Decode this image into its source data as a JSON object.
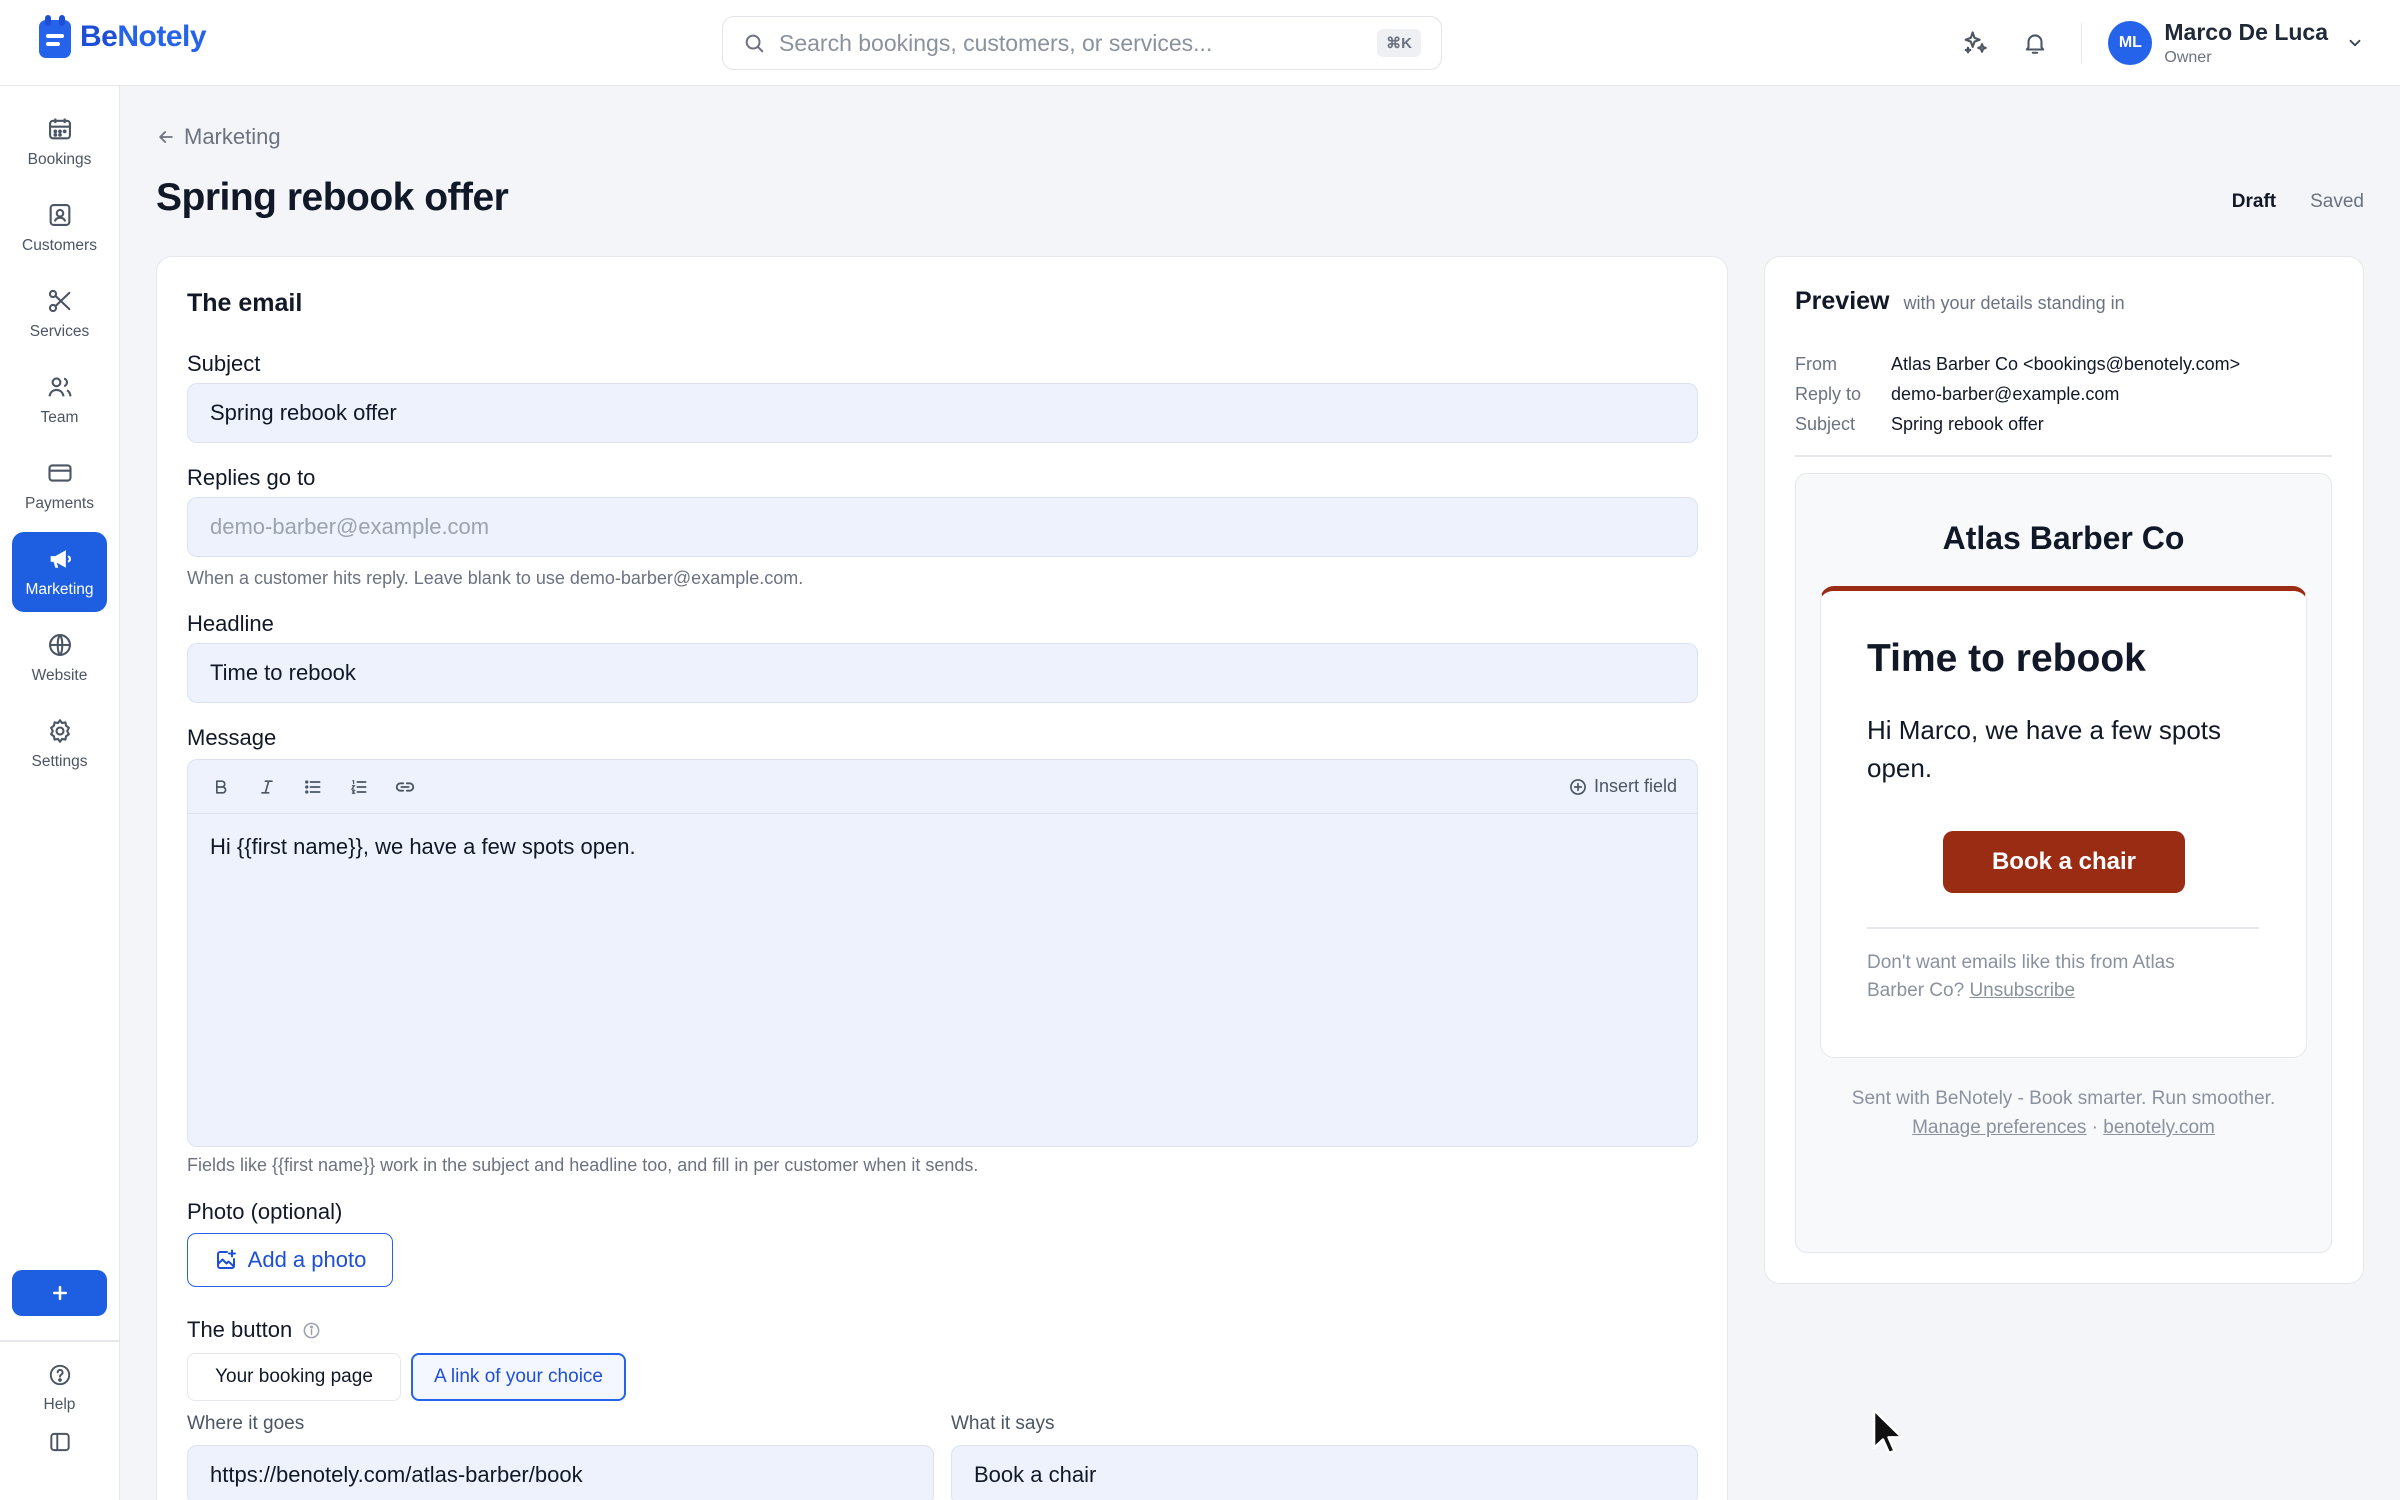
{
  "brand": {
    "name_part1": "Be",
    "name_part2": "Notely",
    "accent": "#2563eb"
  },
  "search": {
    "placeholder": "Search bookings, customers, or services...",
    "shortcut": "⌘K"
  },
  "user": {
    "initials": "ML",
    "name": "Marco De Luca",
    "role": "Owner"
  },
  "sidebar": {
    "items": [
      {
        "label": "Bookings",
        "icon": "calendar-icon",
        "active": false
      },
      {
        "label": "Customers",
        "icon": "contact-icon",
        "active": false
      },
      {
        "label": "Services",
        "icon": "scissors-icon",
        "active": false
      },
      {
        "label": "Team",
        "icon": "users-icon",
        "active": false
      },
      {
        "label": "Payments",
        "icon": "credit-card-icon",
        "active": false
      },
      {
        "label": "Marketing",
        "icon": "megaphone-icon",
        "active": true
      },
      {
        "label": "Website",
        "icon": "globe-icon",
        "active": false
      },
      {
        "label": "Settings",
        "icon": "gear-icon",
        "active": false
      }
    ],
    "help_label": "Help"
  },
  "breadcrumb": {
    "back_label": "Marketing"
  },
  "page": {
    "title": "Spring rebook offer",
    "status_draft": "Draft",
    "status_saved": "Saved"
  },
  "editor": {
    "heading": "The email",
    "subject_label": "Subject",
    "subject_value": "Spring rebook offer",
    "replies_label": "Replies go to",
    "replies_placeholder": "demo-barber@example.com",
    "replies_hint": "When a customer hits reply. Leave blank to use demo-barber@example.com.",
    "headline_label": "Headline",
    "headline_value": "Time to rebook",
    "message_label": "Message",
    "insert_field_label": "Insert field",
    "message_value": "Hi {{first name}}, we have a few spots open.",
    "fields_hint": "Fields like {{first name}} work in the subject and headline too, and fill in per customer when it sends.",
    "photo_label": "Photo (optional)",
    "add_photo_label": "Add a photo",
    "button_heading": "The button",
    "button_options": [
      "Your booking page",
      "A link of your choice"
    ],
    "button_selected": "A link of your choice",
    "where_label": "Where it goes",
    "where_value": "https://benotely.com/atlas-barber/book",
    "what_label": "What it says",
    "what_value": "Book a chair"
  },
  "preview": {
    "title": "Preview",
    "subtitle": "with your details standing in",
    "from_label": "From",
    "from_value": "Atlas Barber Co <bookings@benotely.com>",
    "reply_label": "Reply to",
    "reply_value": "demo-barber@example.com",
    "subject_label": "Subject",
    "subject_value": "Spring rebook offer",
    "email": {
      "brand": "Atlas Barber Co",
      "headline": "Time to rebook",
      "body": "Hi Marco, we have a few spots open.",
      "button": "Book a chair",
      "button_color": "#9b2c14",
      "unsub_text": "Don't want emails like this from Atlas Barber Co?",
      "unsub_link": "Unsubscribe",
      "footer_line": "Sent with BeNotely - Book smarter. Run smoother.",
      "manage_link": "Manage preferences",
      "separator": "·",
      "site_link": "benotely.com"
    }
  }
}
